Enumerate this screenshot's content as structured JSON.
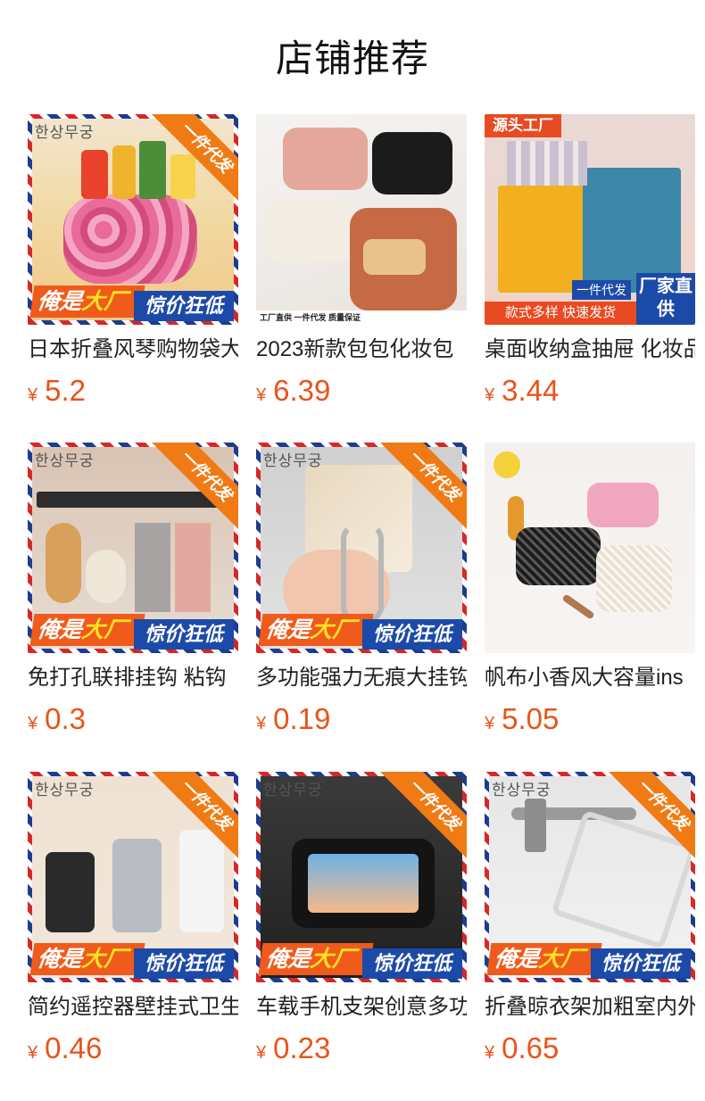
{
  "header": {
    "title": "店铺推荐"
  },
  "currency_symbol": "¥",
  "products": [
    {
      "name": "日本折叠风琴购物袋大容量",
      "price": "5.2",
      "brand": "한상무궁",
      "ribbon": "一件代发",
      "promo_left_a": "俺是",
      "promo_left_b": "大厂",
      "promo_right": "惊价狂低"
    },
    {
      "name": "2023新款包包化妆包",
      "price": "6.39",
      "footer": "工厂直供 一件代发 质量保证"
    },
    {
      "name": "桌面收纳盒抽屉 化妆品",
      "price": "3.44",
      "tag_top": "源头工厂",
      "tag_a": "一件代发",
      "tag_b": "厂家直供",
      "tag_c": "款式多样 快速发货"
    },
    {
      "name": "免打孔联排挂钩 粘钩",
      "price": "0.3",
      "brand": "한상무궁",
      "ribbon": "一件代发",
      "promo_left_a": "俺是",
      "promo_left_b": "大厂",
      "promo_right": "惊价狂低"
    },
    {
      "name": "多功能强力无痕大挂钩",
      "price": "0.19",
      "brand": "한상무궁",
      "ribbon": "一件代发",
      "promo_left_a": "俺是",
      "promo_left_b": "大厂",
      "promo_right": "惊价狂低"
    },
    {
      "name": "帆布小香风大容量ins",
      "price": "5.05"
    },
    {
      "name": "简约遥控器壁挂式卫生间",
      "price": "0.46",
      "brand": "한상무궁",
      "ribbon": "一件代发",
      "promo_left_a": "俺是",
      "promo_left_b": "大厂",
      "promo_right": "惊价狂低"
    },
    {
      "name": "车载手机支架创意多功能",
      "price": "0.23",
      "brand": "한상무궁",
      "ribbon": "一件代发",
      "promo_left_a": "俺是",
      "promo_left_b": "大厂",
      "promo_right": "惊价狂低"
    },
    {
      "name": "折叠晾衣架加粗室内外",
      "price": "0.65",
      "brand": "한상무궁",
      "ribbon": "一件代发",
      "promo_left_a": "俺是",
      "promo_left_b": "大厂",
      "promo_right": "惊价狂低"
    }
  ]
}
